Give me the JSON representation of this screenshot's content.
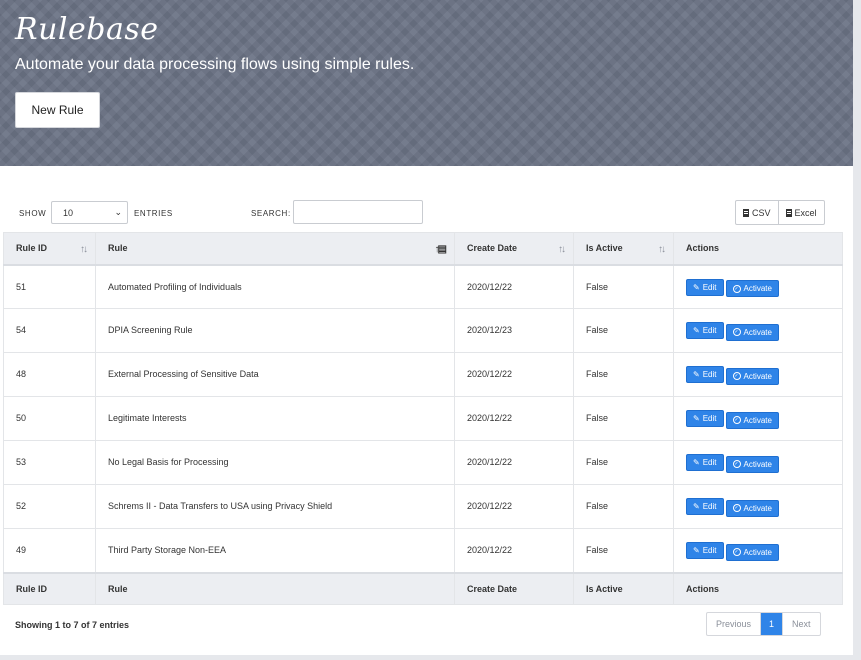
{
  "hero": {
    "title": "Rulebase",
    "subtitle": "Automate your data processing flows using simple rules.",
    "new_rule_label": "New Rule"
  },
  "controls": {
    "show_label": "SHOW",
    "length_value": "10",
    "entries_label": "ENTRIES",
    "search_label": "SEARCH:",
    "search_value": "",
    "export_buttons": [
      {
        "label": "CSV",
        "icon": "file-csv-icon"
      },
      {
        "label": "Excel",
        "icon": "file-excel-icon"
      }
    ]
  },
  "table": {
    "columns": [
      "Rule ID",
      "Rule",
      "Create Date",
      "Is Active",
      "Actions"
    ],
    "rows": [
      {
        "id": "51",
        "rule": "Automated Profiling of Individuals",
        "date": "2020/12/22",
        "active": "False"
      },
      {
        "id": "54",
        "rule": "DPIA Screening Rule",
        "date": "2020/12/23",
        "active": "False"
      },
      {
        "id": "48",
        "rule": "External Processing of Sensitive Data",
        "date": "2020/12/22",
        "active": "False"
      },
      {
        "id": "50",
        "rule": "Legitimate Interests",
        "date": "2020/12/22",
        "active": "False"
      },
      {
        "id": "53",
        "rule": "No Legal Basis for Processing",
        "date": "2020/12/22",
        "active": "False"
      },
      {
        "id": "52",
        "rule": "Schrems II - Data Transfers to USA using Privacy Shield",
        "date": "2020/12/22",
        "active": "False"
      },
      {
        "id": "49",
        "rule": "Third Party Storage Non-EEA",
        "date": "2020/12/22",
        "active": "False"
      }
    ],
    "edit_label": "Edit",
    "activate_label": "Activate"
  },
  "footer": {
    "info": "Showing 1 to 7 of 7 entries",
    "prev_label": "Previous",
    "current_page": "1",
    "next_label": "Next"
  },
  "colors": {
    "hero_bg": "#6b7385",
    "accent": "#2f84e8"
  }
}
